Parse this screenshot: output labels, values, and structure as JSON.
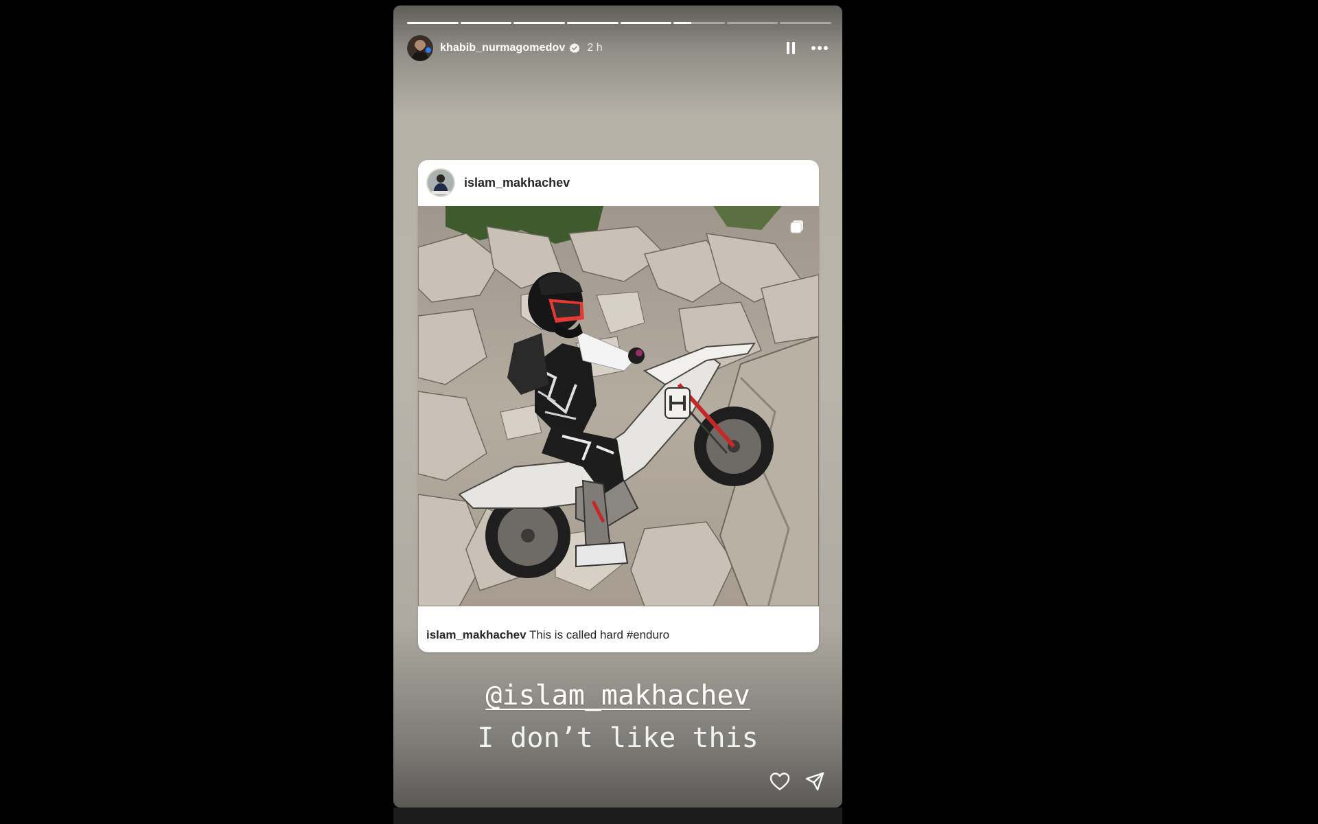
{
  "story": {
    "progress": {
      "segments": 8,
      "completed": 5,
      "current_fraction": 0.35
    },
    "header": {
      "username": "khabib_nurmagomedov",
      "verified": true,
      "time": "2 h",
      "icons": [
        "pause-icon",
        "more-options-icon"
      ]
    },
    "shared_post": {
      "username": "islam_makhachev",
      "caption_user": "islam_makhachev",
      "caption_text": "This is called hard #enduro",
      "icons": [
        "multiple-photos-icon"
      ]
    },
    "mention": "@islam_makhachev",
    "text": "I don’t like this",
    "footer_icons": [
      "like-heart-icon",
      "send-icon"
    ]
  },
  "colors": {
    "background": "#000000",
    "story_gray": "#b6b2a8",
    "card": "#ffffff",
    "text_dark": "#262626",
    "white": "#ffffff"
  }
}
